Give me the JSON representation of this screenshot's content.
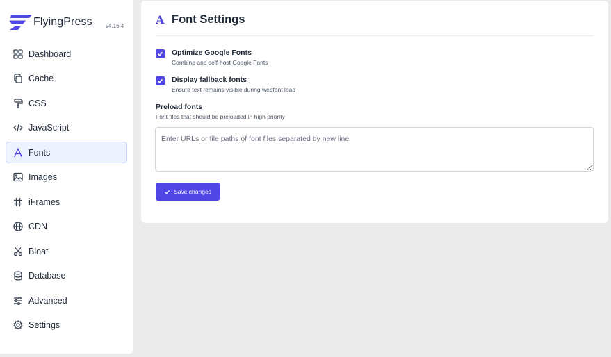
{
  "brand": {
    "name": "FlyingPress",
    "version": "v4.16.4"
  },
  "nav": [
    {
      "label": "Dashboard",
      "icon": "grid-icon",
      "active": false
    },
    {
      "label": "Cache",
      "icon": "copy-icon",
      "active": false
    },
    {
      "label": "CSS",
      "icon": "paint-roller-icon",
      "active": false
    },
    {
      "label": "JavaScript",
      "icon": "code-icon",
      "active": false
    },
    {
      "label": "Fonts",
      "icon": "font-icon",
      "active": true
    },
    {
      "label": "Images",
      "icon": "image-icon",
      "active": false
    },
    {
      "label": "iFrames",
      "icon": "hash-icon",
      "active": false
    },
    {
      "label": "CDN",
      "icon": "globe-icon",
      "active": false
    },
    {
      "label": "Bloat",
      "icon": "scissors-icon",
      "active": false
    },
    {
      "label": "Database",
      "icon": "database-icon",
      "active": false
    },
    {
      "label": "Advanced",
      "icon": "sliders-icon",
      "active": false
    },
    {
      "label": "Settings",
      "icon": "gear-icon",
      "active": false
    }
  ],
  "main": {
    "title_icon": "A",
    "title": "Font Settings",
    "options": [
      {
        "label": "Optimize Google Fonts",
        "description": "Combine and self-host Google Fonts",
        "checked": true
      },
      {
        "label": "Display fallback fonts",
        "description": "Ensure text remains visible during webfont load",
        "checked": true
      }
    ],
    "preload": {
      "label": "Preload fonts",
      "description": "Font files that should be preloaded in high priority",
      "placeholder": "Enter URLs or file paths of font files separated by new line",
      "value": ""
    },
    "save_label": "Save changes"
  },
  "colors": {
    "accent": "#4f46e5",
    "active_bg": "#eef2ff",
    "page_bg": "#ebebeb"
  }
}
